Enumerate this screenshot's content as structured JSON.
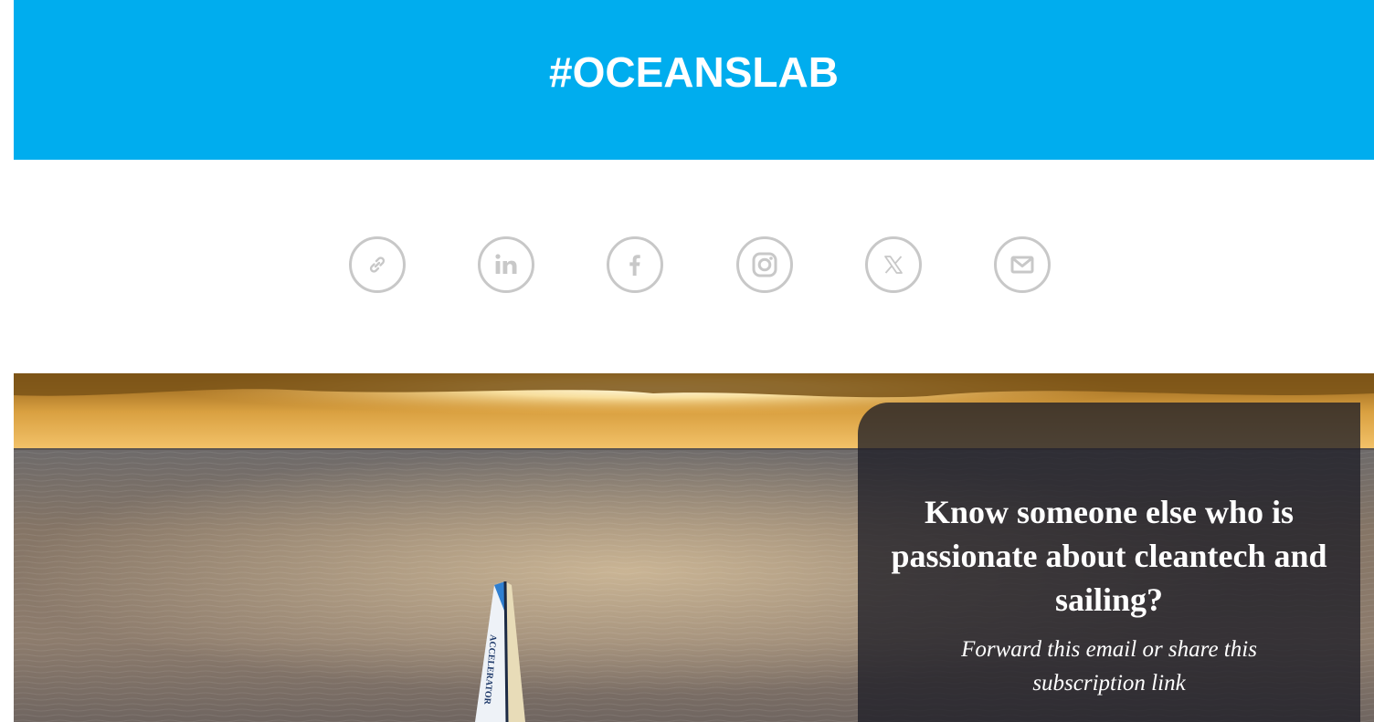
{
  "header": {
    "title": "#OCEANSLAB",
    "background_color": "#00adee"
  },
  "social_links": [
    {
      "icon": "link-icon"
    },
    {
      "icon": "linkedin-icon"
    },
    {
      "icon": "facebook-icon"
    },
    {
      "icon": "instagram-icon"
    },
    {
      "icon": "x-icon"
    },
    {
      "icon": "email-icon"
    }
  ],
  "hero": {
    "sail_text": "ACCELERATOR",
    "share_card": {
      "heading": "Know someone else who is passionate about cleantech and sailing?",
      "subtext": "Forward this email or share this subscription link"
    }
  }
}
